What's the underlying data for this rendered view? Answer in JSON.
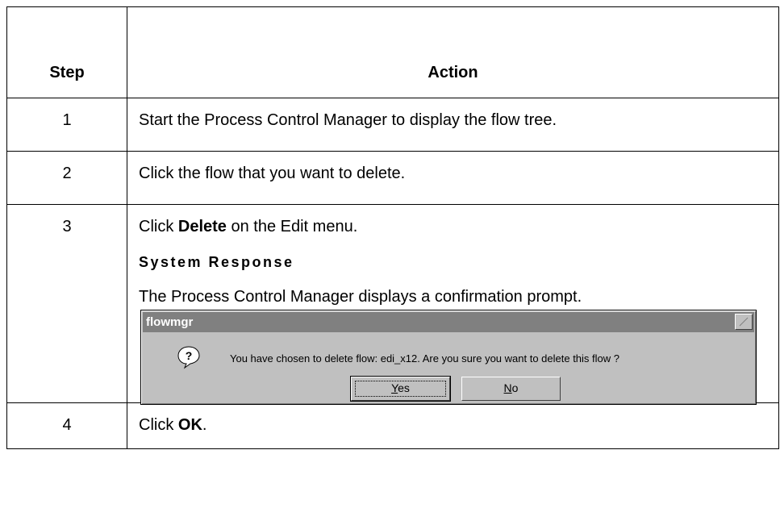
{
  "table": {
    "header": {
      "step": "Step",
      "action": "Action"
    },
    "rows": [
      {
        "step": "1",
        "action": "Start the Process Control Manager to display the flow tree."
      },
      {
        "step": "2",
        "action": "Click the flow that you want to delete."
      },
      {
        "step": "3",
        "action_prefix": "Click ",
        "action_bold": "Delete",
        "action_suffix": " on the Edit menu.",
        "subheading": "System Response",
        "response": "The Process Control Manager displays a confirmation prompt."
      },
      {
        "step": "4",
        "action_prefix": "Click ",
        "action_bold": "OK",
        "action_suffix": "."
      }
    ]
  },
  "dialog": {
    "title": "flowmgr",
    "icon": "question-icon",
    "message": "You have chosen to delete flow: edi_x12.  Are you sure you want to delete this flow ?",
    "yes_mnemonic": "Y",
    "yes_rest": "es",
    "no_mnemonic": "N",
    "no_rest": "o"
  },
  "colors": {
    "dialog_face": "#c0c0c0",
    "titlebar": "#808080"
  }
}
